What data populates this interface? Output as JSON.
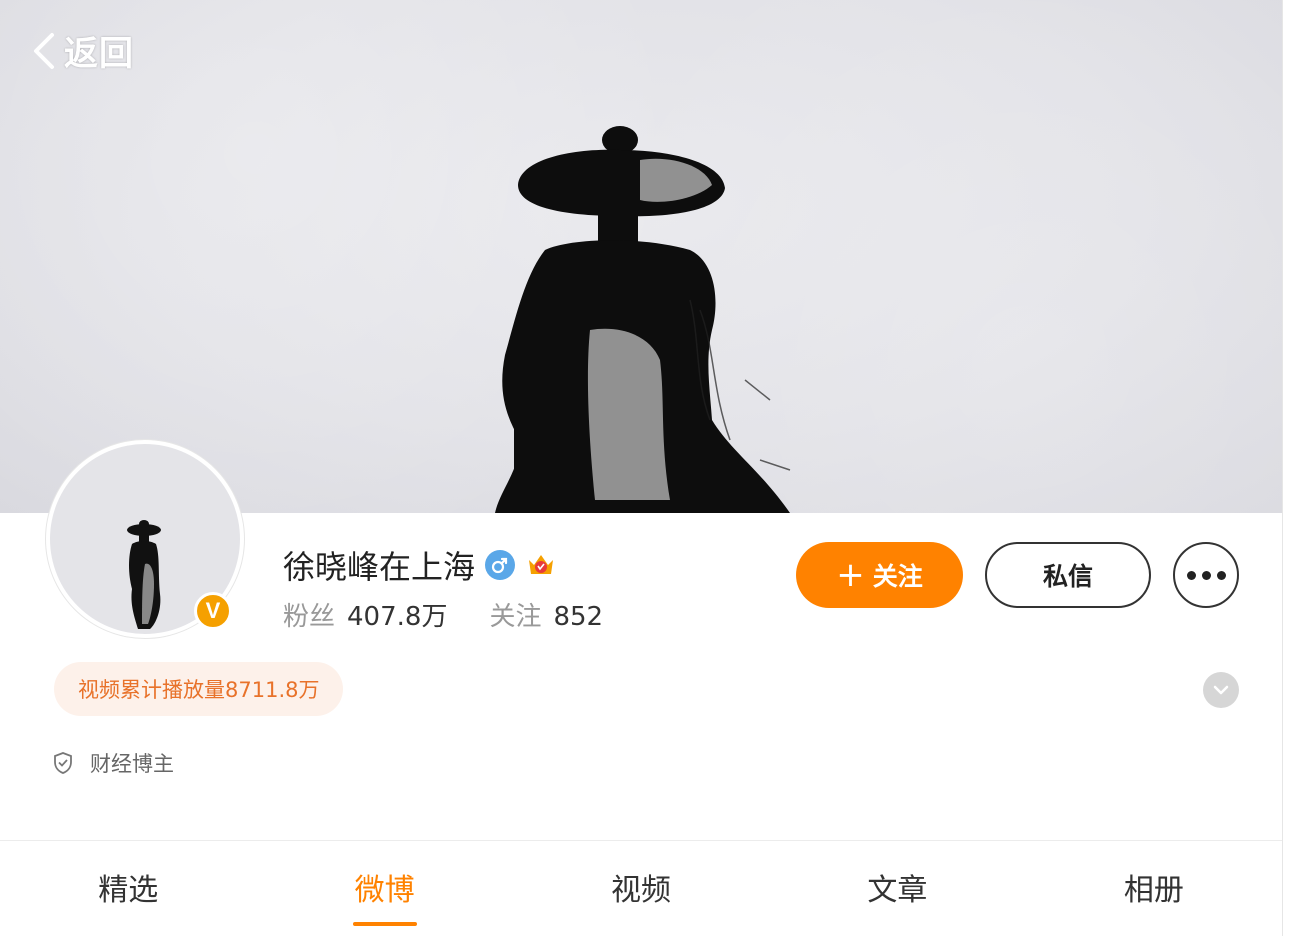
{
  "header": {
    "back_label": "返回"
  },
  "profile": {
    "name": "徐晓峰在上海",
    "verified_badge": "V",
    "gender_icon": "male-icon",
    "member_icon": "crown-icon",
    "fans_label": "粉丝",
    "fans_value": "407.8万",
    "following_label": "关注",
    "following_value": "852"
  },
  "actions": {
    "follow_label": "关注",
    "follow_plus": "+",
    "message_label": "私信",
    "more_icon": "more-dots-icon"
  },
  "info": {
    "play_count_tag": "视频累计播放量8711.8万",
    "category_tag": "财经博主"
  },
  "tabs": [
    {
      "label": "精选",
      "active": false
    },
    {
      "label": "微博",
      "active": true
    },
    {
      "label": "视频",
      "active": false
    },
    {
      "label": "文章",
      "active": false
    },
    {
      "label": "相册",
      "active": false
    }
  ],
  "colors": {
    "accent": "#ff8200",
    "tag_bg": "#fdf1ea",
    "tag_text": "#e8722a",
    "verified": "#f5a000"
  }
}
